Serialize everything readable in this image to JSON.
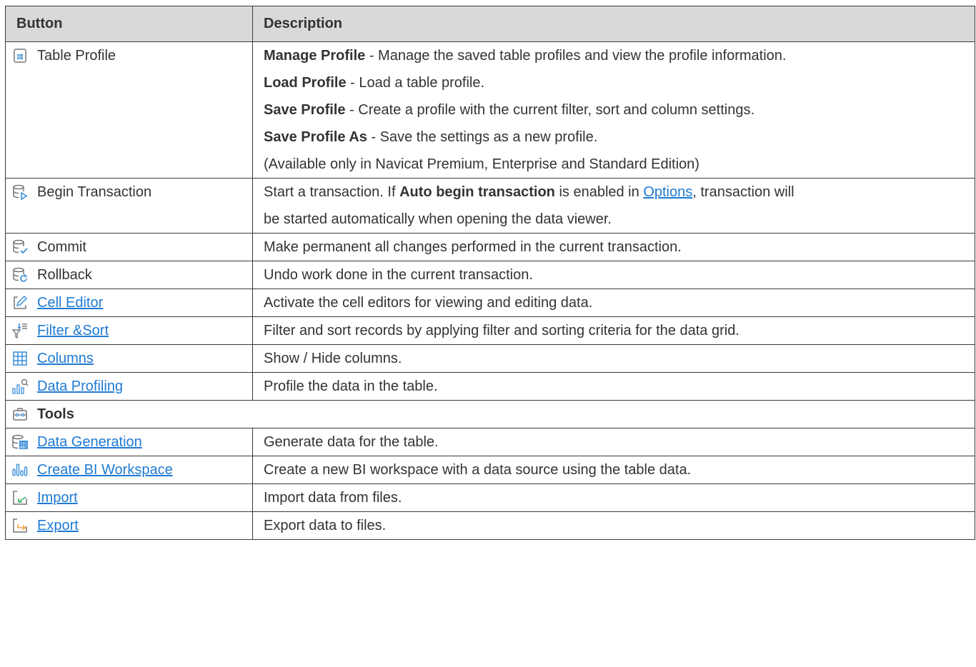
{
  "header": {
    "button": "Button",
    "description": "Description"
  },
  "table_profile": {
    "label": "Table Profile",
    "icon": "table-profile-icon",
    "items": [
      {
        "bold": "Manage Profile",
        "text": " - Manage the saved table profiles and view the profile information."
      },
      {
        "bold": "Load Profile",
        "text": " - Load a table profile."
      },
      {
        "bold": "Save Profile",
        "text": " - Create a profile with the current filter, sort and column settings."
      },
      {
        "bold": "Save Profile As",
        "text": " - Save the settings as a new profile."
      }
    ],
    "note": "(Available only in Navicat Premium, Enterprise and Standard Edition)"
  },
  "begin_transaction": {
    "label": "Begin Transaction",
    "icon": "begin-transaction-icon",
    "line1_a": "Start a transaction. If ",
    "line1_bold": "Auto begin transaction",
    "line1_b": " is enabled in ",
    "line1_link": "Options",
    "line1_c": ", transaction will",
    "line2": "be started automatically when opening the data viewer."
  },
  "rows": [
    {
      "label": "Commit",
      "icon": "commit-icon",
      "link": false,
      "desc": "Make permanent all changes performed in the current transaction."
    },
    {
      "label": "Rollback",
      "icon": "rollback-icon",
      "link": false,
      "desc": "Undo work done in the current transaction."
    },
    {
      "label": "Cell Editor",
      "icon": "cell-editor-icon",
      "link": true,
      "desc": "Activate the cell editors for viewing and editing data."
    },
    {
      "label": "Filter &Sort",
      "icon": "filter-sort-icon",
      "link": true,
      "desc": "Filter and sort records by applying filter and sorting criteria for the data grid."
    },
    {
      "label": "Columns",
      "icon": "columns-icon",
      "link": true,
      "desc": "Show / Hide columns."
    },
    {
      "label": "Data Profiling",
      "icon": "data-profiling-icon",
      "link": true,
      "desc": "Profile the data in the table."
    }
  ],
  "tools": {
    "label": "Tools",
    "icon": "tools-icon"
  },
  "tool_rows": [
    {
      "label": "Data Generation",
      "icon": "data-generation-icon",
      "link": true,
      "desc": "Generate data for the table."
    },
    {
      "label": "Create BI Workspace",
      "icon": "bi-workspace-icon",
      "link": true,
      "desc": "Create a new BI workspace with a data source using the table data."
    },
    {
      "label": "Import",
      "icon": "import-icon",
      "link": true,
      "desc": "Import data from files."
    },
    {
      "label": "Export",
      "icon": "export-icon",
      "link": true,
      "desc": "Export data to files."
    }
  ],
  "colors": {
    "link": "#1e7ad3",
    "icon_blue": "#3a8fd8",
    "header_bg": "#d9d9d9",
    "border": "#3a3a3a"
  }
}
